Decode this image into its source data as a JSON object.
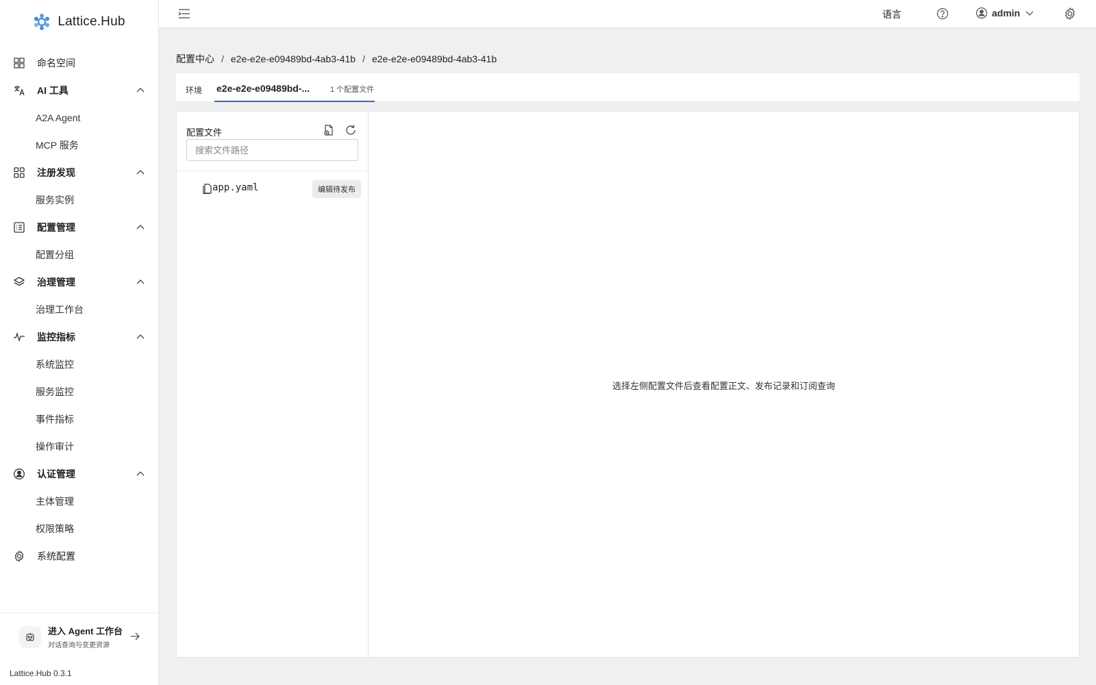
{
  "app": {
    "brand": "Lattice.Hub",
    "version": "Lattice.Hub 0.3.1"
  },
  "sidebar": {
    "items": [
      {
        "label": "命名空间",
        "icon": "namespace-icon"
      },
      {
        "label": "AI 工具",
        "icon": "translate-icon",
        "children": [
          "A2A Agent",
          "MCP 服务"
        ]
      },
      {
        "label": "注册发现",
        "icon": "grid-icon",
        "children": [
          "服务实例"
        ]
      },
      {
        "label": "配置管理",
        "icon": "list-icon",
        "children": [
          "配置分组"
        ]
      },
      {
        "label": "治理管理",
        "icon": "layers-icon",
        "children": [
          "治理工作台"
        ]
      },
      {
        "label": "监控指标",
        "icon": "pulse-icon",
        "children": [
          "系统监控",
          "服务监控",
          "事件指标",
          "操作审计"
        ]
      },
      {
        "label": "认证管理",
        "icon": "user-shield-icon",
        "children": [
          "主体管理",
          "权限策略"
        ]
      },
      {
        "label": "系统配置",
        "icon": "gear-icon"
      }
    ],
    "agent": {
      "title": "进入 Agent 工作台",
      "subtitle": "对话查询与变更资源"
    }
  },
  "header": {
    "language": "语言",
    "user": "admin"
  },
  "breadcrumb": {
    "root": "配置中心",
    "group": "e2e-e2e-e09489bd-4ab3-41b",
    "current": "e2e-e2e-e09489bd-4ab3-41b"
  },
  "tabs": {
    "env": "环境",
    "active_name": "e2e-e2e-e09489bd-...",
    "active_count": "1 个配置文件"
  },
  "files": {
    "title": "配置文件",
    "search_placeholder": "搜索文件路径",
    "list": [
      {
        "name": "app.yaml",
        "status": "编辑待发布"
      }
    ],
    "empty_hint": "选择左侧配置文件后查看配置正文、发布记录和订阅查询"
  },
  "colors": {
    "accent": "#1f6fd1",
    "logo": "#4a90e2"
  }
}
